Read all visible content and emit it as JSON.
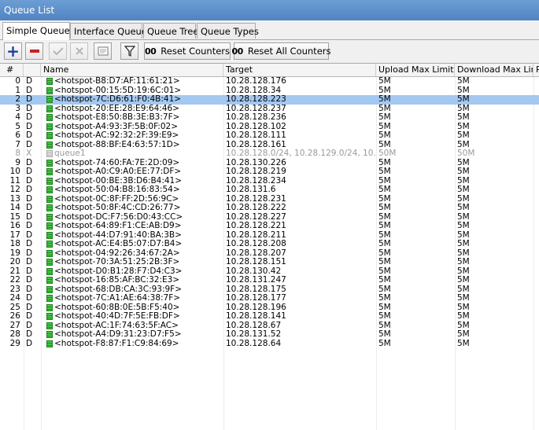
{
  "window": {
    "title": "Queue List"
  },
  "tabs": [
    {
      "label": "Simple Queues",
      "active": true
    },
    {
      "label": "Interface Queues",
      "active": false
    },
    {
      "label": "Queue Tree",
      "active": false
    },
    {
      "label": "Queue Types",
      "active": false
    }
  ],
  "toolbar": {
    "reset_counters_label": "Reset Counters",
    "reset_all_counters_label": "Reset All Counters",
    "counter_glyph": "00"
  },
  "table": {
    "columns": [
      "#",
      "",
      "Name",
      "Target",
      "Upload Max Limit",
      "Download Max Limit",
      "P"
    ],
    "rows": [
      {
        "num": "0",
        "flag": "D",
        "name": "<hotspot-B8:D7:AF:11:61:21>",
        "target": "10.28.128.176",
        "up": "5M",
        "down": "5M"
      },
      {
        "num": "1",
        "flag": "D",
        "name": "<hotspot-00:15:5D:19:6C:01>",
        "target": "10.28.128.34",
        "up": "5M",
        "down": "5M"
      },
      {
        "num": "2",
        "flag": "D",
        "name": "<hotspot-7C:D6:61:F0:4B:41>",
        "target": "10.28.128.223",
        "up": "5M",
        "down": "5M",
        "selected": true
      },
      {
        "num": "3",
        "flag": "D",
        "name": "<hotspot-20:EE:28:E9:64:46>",
        "target": "10.28.128.237",
        "up": "5M",
        "down": "5M"
      },
      {
        "num": "4",
        "flag": "D",
        "name": "<hotspot-E8:50:8B:3E:B3:7F>",
        "target": "10.28.128.236",
        "up": "5M",
        "down": "5M"
      },
      {
        "num": "5",
        "flag": "D",
        "name": "<hotspot-A4:93:3F:5B:0F:02>",
        "target": "10.28.128.102",
        "up": "5M",
        "down": "5M"
      },
      {
        "num": "6",
        "flag": "D",
        "name": "<hotspot-AC:92:32:2F:39:E9>",
        "target": "10.28.128.111",
        "up": "5M",
        "down": "5M"
      },
      {
        "num": "7",
        "flag": "D",
        "name": "<hotspot-88:BF:E4:63:57:1D>",
        "target": "10.28.128.161",
        "up": "5M",
        "down": "5M"
      },
      {
        "num": "8",
        "flag": "X",
        "name": "queue1",
        "target": "10.28.128.0/24, 10.28.129.0/24, 10....",
        "up": "50M",
        "down": "50M",
        "disabled": true
      },
      {
        "num": "9",
        "flag": "D",
        "name": "<hotspot-74:60:FA:7E:2D:09>",
        "target": "10.28.130.226",
        "up": "5M",
        "down": "5M"
      },
      {
        "num": "10",
        "flag": "D",
        "name": "<hotspot-A0:C9:A0:EE:77:DF>",
        "target": "10.28.128.219",
        "up": "5M",
        "down": "5M"
      },
      {
        "num": "11",
        "flag": "D",
        "name": "<hotspot-00:BE:3B:D6:B4:41>",
        "target": "10.28.128.234",
        "up": "5M",
        "down": "5M"
      },
      {
        "num": "12",
        "flag": "D",
        "name": "<hotspot-50:04:B8:16:83:54>",
        "target": "10.28.131.6",
        "up": "5M",
        "down": "5M"
      },
      {
        "num": "13",
        "flag": "D",
        "name": "<hotspot-0C:8F:FF:2D:56:9C>",
        "target": "10.28.128.231",
        "up": "5M",
        "down": "5M"
      },
      {
        "num": "14",
        "flag": "D",
        "name": "<hotspot-50:8F:4C:CD:26:77>",
        "target": "10.28.128.222",
        "up": "5M",
        "down": "5M"
      },
      {
        "num": "15",
        "flag": "D",
        "name": "<hotspot-DC:F7:56:D0:43:CC>",
        "target": "10.28.128.227",
        "up": "5M",
        "down": "5M"
      },
      {
        "num": "16",
        "flag": "D",
        "name": "<hotspot-64:89:F1:CE:AB:D9>",
        "target": "10.28.128.221",
        "up": "5M",
        "down": "5M"
      },
      {
        "num": "17",
        "flag": "D",
        "name": "<hotspot-44:D7:91:40:BA:3B>",
        "target": "10.28.128.211",
        "up": "5M",
        "down": "5M"
      },
      {
        "num": "18",
        "flag": "D",
        "name": "<hotspot-AC:E4:B5:07:D7:B4>",
        "target": "10.28.128.208",
        "up": "5M",
        "down": "5M"
      },
      {
        "num": "19",
        "flag": "D",
        "name": "<hotspot-04:92:26:34:67:2A>",
        "target": "10.28.128.207",
        "up": "5M",
        "down": "5M"
      },
      {
        "num": "20",
        "flag": "D",
        "name": "<hotspot-70:3A:51:25:2B:3F>",
        "target": "10.28.128.151",
        "up": "5M",
        "down": "5M"
      },
      {
        "num": "21",
        "flag": "D",
        "name": "<hotspot-D0:B1:28:F7:D4:C3>",
        "target": "10.28.130.42",
        "up": "5M",
        "down": "5M"
      },
      {
        "num": "22",
        "flag": "D",
        "name": "<hotspot-16:85:AF:BC:32:E3>",
        "target": "10.28.131.247",
        "up": "5M",
        "down": "5M"
      },
      {
        "num": "23",
        "flag": "D",
        "name": "<hotspot-68:DB:CA:3C:93:9F>",
        "target": "10.28.128.175",
        "up": "5M",
        "down": "5M"
      },
      {
        "num": "24",
        "flag": "D",
        "name": "<hotspot-7C:A1:AE:64:38:7F>",
        "target": "10.28.128.177",
        "up": "5M",
        "down": "5M"
      },
      {
        "num": "25",
        "flag": "D",
        "name": "<hotspot-60:8B:0E:5B:F5:40>",
        "target": "10.28.128.196",
        "up": "5M",
        "down": "5M"
      },
      {
        "num": "26",
        "flag": "D",
        "name": "<hotspot-40:4D:7F:5E:FB:DF>",
        "target": "10.28.128.141",
        "up": "5M",
        "down": "5M"
      },
      {
        "num": "27",
        "flag": "D",
        "name": "<hotspot-AC:1F:74:63:5F:AC>",
        "target": "10.28.128.67",
        "up": "5M",
        "down": "5M"
      },
      {
        "num": "28",
        "flag": "D",
        "name": "<hotspot-A4:D9:31:23:D7:F5>",
        "target": "10.28.131.52",
        "up": "5M",
        "down": "5M"
      },
      {
        "num": "29",
        "flag": "D",
        "name": "<hotspot-F8:87:F1:C9:84:69>",
        "target": "10.28.128.64",
        "up": "5M",
        "down": "5M"
      }
    ]
  },
  "colors": {
    "titlebar": "#5a8fcf",
    "selection": "#a4c8f0",
    "queue_icon": "#2ea82e",
    "add_icon": "#1d3f9e",
    "remove_icon": "#c72222"
  }
}
